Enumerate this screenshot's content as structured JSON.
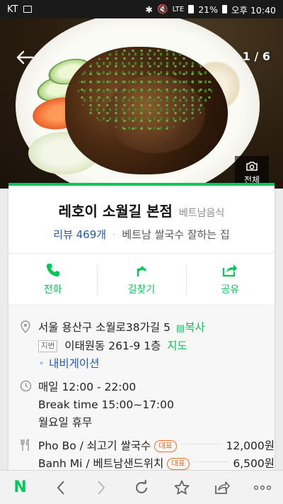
{
  "status_bar": {
    "carrier": "KT",
    "battery_percent": "21%",
    "time": "오후 10:40",
    "network_label": "LTE"
  },
  "photo": {
    "counter": "1 / 6",
    "view_all_label": "전체"
  },
  "place": {
    "name": "레호이 소월길 본점",
    "category": "베트남음식",
    "review_label": "리뷰 469개",
    "tagline": "베트남 쌀국수 잘하는 집"
  },
  "actions": [
    {
      "label": "전화",
      "icon": "phone-icon"
    },
    {
      "label": "길찾기",
      "icon": "directions-icon"
    },
    {
      "label": "공유",
      "icon": "share-icon"
    }
  ],
  "address": {
    "road": "서울 용산구 소월로38가길 5",
    "copy_label": "복사",
    "jibeon_tag": "지번",
    "jibeon": "이태원동 261-9 1층",
    "map_label": "지도",
    "navi_label": "내비게이션"
  },
  "hours": {
    "line1": "매일 12:00 - 22:00",
    "line2": "Break time 15:00~17:00",
    "line3": "월요일 휴무"
  },
  "menu": [
    {
      "name": "Pho Bo / 쇠고기 쌀국수",
      "badge": "대표",
      "price": "12,000원"
    },
    {
      "name": "Banh Mi / 베트남샌드위치",
      "badge": "대표",
      "price": "6,500원"
    }
  ],
  "colors": {
    "accent": "#03c75a",
    "link": "#1e5ab3",
    "badge": "#f26d21"
  }
}
